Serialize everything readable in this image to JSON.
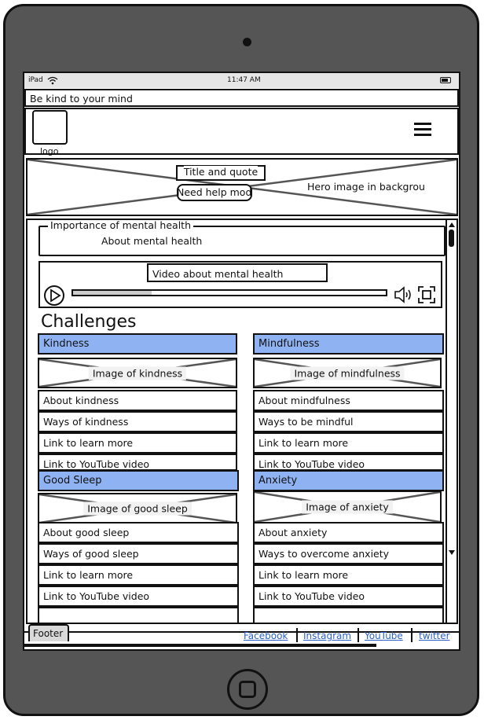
{
  "device": {
    "status_left": "iPad",
    "time": "11:47 AM",
    "wifi_icon": "wifi-icon",
    "battery_icon": "battery-icon"
  },
  "banner": "Be kind to your mind",
  "nav": {
    "logo_label": "logo",
    "menu_icon": "hamburger-menu-icon"
  },
  "hero": {
    "title": "Title and quote",
    "button": "Need help mode",
    "background_label": "Hero image in backgrou"
  },
  "importance": {
    "legend": "Importance of mental health",
    "text": "About mental health"
  },
  "video": {
    "title": "Video about mental health",
    "progress": 0.25,
    "play_icon": "play-icon",
    "volume_icon": "volume-icon",
    "fullscreen_icon": "fullscreen-icon"
  },
  "challenges_title": "Challenges",
  "cards": [
    {
      "header": "Kindness",
      "image": "Image of kindness",
      "about": "About kindness",
      "ways": "Ways of kindness",
      "learn": "Link to learn more",
      "youtube": "Link to YouTube video"
    },
    {
      "header": "Mindfulness",
      "image": "Image of mindfulness",
      "about": "About mindfulness",
      "ways": "Ways to be mindful",
      "learn": "Link to learn more",
      "youtube": "Link to YouTube video"
    },
    {
      "header": "Good Sleep",
      "image": "Image of good sleep",
      "about": "About good sleep",
      "ways": "Ways of good sleep",
      "learn": "Link to learn more",
      "youtube": "Link to YouTube video"
    },
    {
      "header": "Anxiety",
      "image": "Image of anxiety",
      "about": "About anxiety",
      "ways": "Ways to overcome anxiety",
      "learn": "Link to learn more",
      "youtube": "Link to YouTube video"
    }
  ],
  "footer": {
    "tab": "Footer",
    "links": [
      "Facebook",
      "Instagram",
      "YouTube",
      "twitter"
    ]
  },
  "colors": {
    "device": "#555555",
    "card_header": "#8fb3f2",
    "link": "#2a62c9"
  }
}
